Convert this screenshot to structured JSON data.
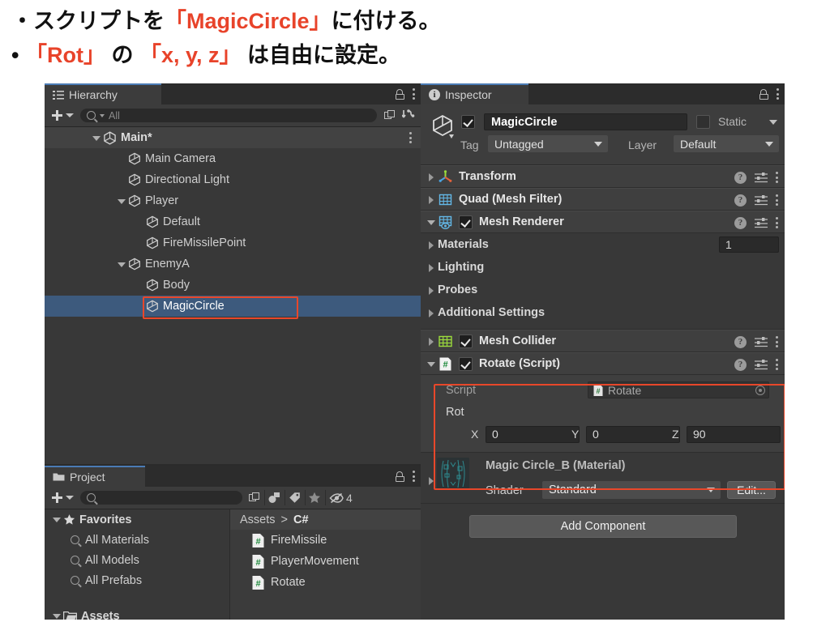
{
  "slide": {
    "line1": {
      "pre": "・スクリプトを",
      "accent": "「MagicCircle」",
      "post": "に付ける。"
    },
    "line2": {
      "bullet": "•",
      "accent1": "「Rot」",
      "mid": "の",
      "accent2": "「x, y, z」",
      "post": "は自由に設定。"
    },
    "accent_color": "#e8432a"
  },
  "hierarchy": {
    "tab_label": "Hierarchy",
    "create_label": "+",
    "search_placeholder": "All",
    "root": {
      "label": "Main*"
    },
    "items": [
      {
        "label": "Main Camera",
        "indent": 2,
        "twist": "none"
      },
      {
        "label": "Directional Light",
        "indent": 2,
        "twist": "none"
      },
      {
        "label": "Player",
        "indent": 2,
        "twist": "down"
      },
      {
        "label": "Default",
        "indent": 3,
        "twist": "none"
      },
      {
        "label": "FireMissilePoint",
        "indent": 3,
        "twist": "none"
      },
      {
        "label": "EnemyA",
        "indent": 2,
        "twist": "down"
      },
      {
        "label": "Body",
        "indent": 3,
        "twist": "none"
      },
      {
        "label": "MagicCircle",
        "indent": 3,
        "twist": "none",
        "selected": true,
        "highlighted": true
      }
    ]
  },
  "project": {
    "tab_label": "Project",
    "search_placeholder": "",
    "hidden_count": "4",
    "favorites_label": "Favorites",
    "favorites": [
      "All Materials",
      "All Models",
      "All Prefabs"
    ],
    "assets_label": "Assets",
    "breadcrumb": {
      "root": "Assets",
      "sep": ">",
      "current": "C#"
    },
    "files": [
      "FireMissile",
      "PlayerMovement",
      "Rotate"
    ]
  },
  "inspector": {
    "tab_label": "Inspector",
    "object": {
      "name": "MagicCircle",
      "enabled": true,
      "static_label": "Static",
      "static_checked": false,
      "tag_label": "Tag",
      "tag_value": "Untagged",
      "layer_label": "Layer",
      "layer_value": "Default"
    },
    "components": [
      {
        "name": "Transform",
        "icon": "transform-icon",
        "twist": "right",
        "has_checkbox": false
      },
      {
        "name": "Quad (Mesh Filter)",
        "icon": "mesh-filter-icon",
        "twist": "right",
        "has_checkbox": false
      },
      {
        "name": "Mesh Renderer",
        "icon": "mesh-renderer-icon",
        "twist": "down",
        "has_checkbox": true,
        "checked": true
      }
    ],
    "mesh_renderer_sections": [
      {
        "label": "Materials",
        "count": "1"
      },
      {
        "label": "Lighting"
      },
      {
        "label": "Probes"
      },
      {
        "label": "Additional Settings"
      }
    ],
    "mesh_collider": {
      "name": "Mesh Collider",
      "twist": "right",
      "checked": true
    },
    "rotate_script": {
      "name": "Rotate (Script)",
      "twist": "down",
      "checked": true,
      "script_label": "Script",
      "script_value": "Rotate",
      "rot_label": "Rot",
      "axes": [
        {
          "label": "X",
          "value": "0"
        },
        {
          "label": "Y",
          "value": "0"
        },
        {
          "label": "Z",
          "value": "90"
        }
      ]
    },
    "material": {
      "title": "Magic Circle_B (Material)",
      "shader_label": "Shader",
      "shader_value": "Standard",
      "edit_label": "Edit..."
    },
    "add_component_label": "Add Component"
  }
}
